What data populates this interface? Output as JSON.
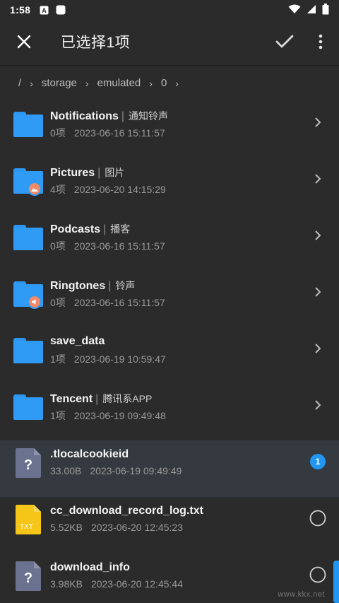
{
  "statusbar": {
    "time": "1:58"
  },
  "appbar": {
    "title": "已选择1项"
  },
  "breadcrumb": [
    "/",
    "storage",
    "emulated",
    "0"
  ],
  "rows": [
    {
      "name": "Notifications",
      "tag": "通知铃声",
      "count": "0项",
      "date": "2023-06-16 15:11:57",
      "kind": "folder"
    },
    {
      "name": "Pictures",
      "tag": "图片",
      "count": "4项",
      "date": "2023-06-20 14:15:29",
      "kind": "folder-pictures"
    },
    {
      "name": "Podcasts",
      "tag": "播客",
      "count": "0项",
      "date": "2023-06-16 15:11:57",
      "kind": "folder"
    },
    {
      "name": "Ringtones",
      "tag": "铃声",
      "count": "0项",
      "date": "2023-06-16 15:11:57",
      "kind": "folder-audio"
    },
    {
      "name": "save_data",
      "tag": "",
      "count": "1项",
      "date": "2023-06-19 10:59:47",
      "kind": "folder"
    },
    {
      "name": "Tencent",
      "tag": "腾讯系APP",
      "count": "1项",
      "date": "2023-06-19 09:49:48",
      "kind": "folder"
    },
    {
      "name": ".tlocalcookieid",
      "tag": "",
      "count": "33.00B",
      "date": "2023-06-19 09:49:49",
      "kind": "file-unknown",
      "selected_index": "1"
    },
    {
      "name": "cc_download_record_log.txt",
      "tag": "",
      "count": "5.52KB",
      "date": "2023-06-20 12:45:23",
      "kind": "file-txt",
      "icon_label": "TXT"
    },
    {
      "name": "download_info",
      "tag": "",
      "count": "3.98KB",
      "date": "2023-06-20 12:45:44",
      "kind": "file-unknown"
    }
  ],
  "watermark": "www.kkx.net",
  "colors": {
    "background": "#2b2b2b",
    "folder": "#2f9bf5",
    "accent": "#2196f3",
    "selected_row": "#343a40"
  }
}
